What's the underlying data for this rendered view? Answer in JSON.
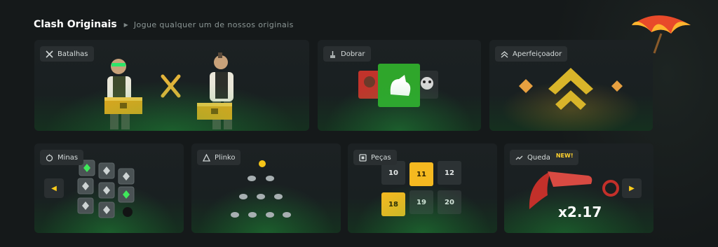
{
  "header": {
    "title": "Clash Originais",
    "subtitle": "Jogue qualquer um de nossos originais"
  },
  "colors": {
    "background": "#15191a",
    "card": "#1c2123",
    "accent_gold": "#f5b920",
    "accent_green": "#28b446"
  },
  "cards": {
    "batalhas": {
      "label": "Batalhas",
      "icon": "crossed-swords-icon"
    },
    "dobrar": {
      "label": "Dobrar",
      "icon": "double-arrow-icon"
    },
    "aperfeicoador": {
      "label": "Aperfeiçoador",
      "icon": "chevrons-up-icon"
    },
    "minas": {
      "label": "Minas",
      "icon": "mine-icon"
    },
    "plinko": {
      "label": "Plinko",
      "icon": "triangle-dots-icon"
    },
    "pecas": {
      "label": "Peças",
      "icon": "tile-icon",
      "tiles": [
        "10",
        "11",
        "12",
        "18",
        "19",
        "20"
      ],
      "highlighted": [
        "11",
        "18"
      ]
    },
    "queda": {
      "label": "Queda",
      "badge": "NEW!",
      "icon": "trend-down-icon",
      "multiplier": "x2.17"
    }
  },
  "navigation": {
    "prev_icon": "caret-left-icon",
    "next_icon": "caret-right-icon"
  }
}
